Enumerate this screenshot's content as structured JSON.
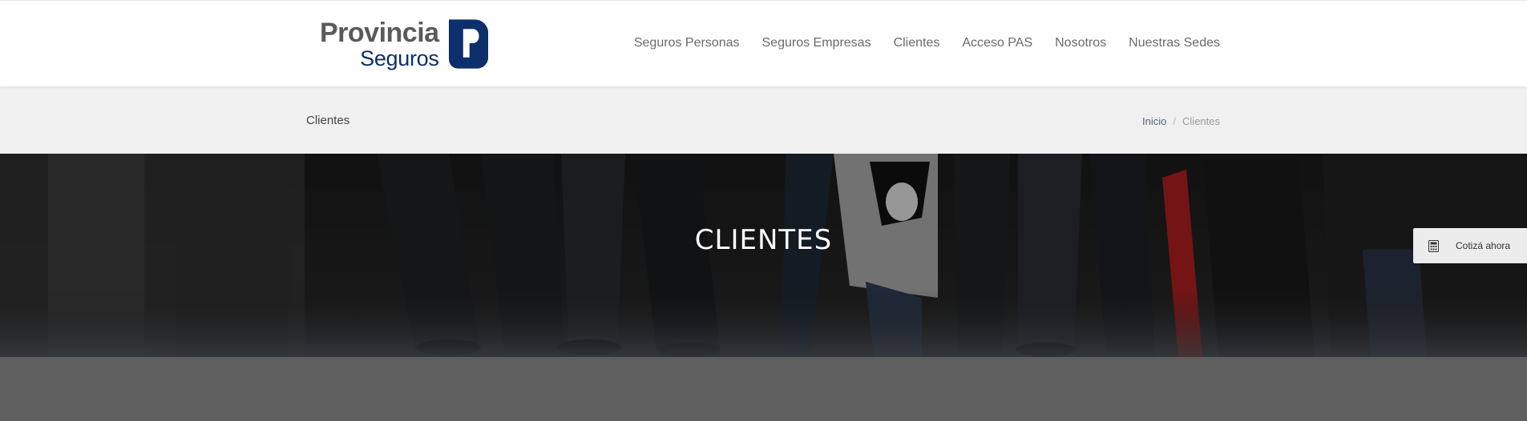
{
  "brand": {
    "top": "Provincia",
    "bottom": "Seguros",
    "logo_icon": "provincia-p-mark",
    "colors": {
      "gray": "#5a5a5a",
      "blue": "#0d2f6b"
    }
  },
  "nav": {
    "items": [
      {
        "label": "Seguros Personas"
      },
      {
        "label": "Seguros Empresas"
      },
      {
        "label": "Clientes"
      },
      {
        "label": "Acceso PAS"
      },
      {
        "label": "Nosotros"
      },
      {
        "label": "Nuestras Sedes"
      }
    ]
  },
  "subheader": {
    "title": "Clientes",
    "breadcrumb": {
      "home": "Inicio",
      "separator": "/",
      "current": "Clientes"
    }
  },
  "hero": {
    "title": "CLIENTES"
  },
  "quote_tab": {
    "icon": "calculator-icon",
    "label": "Cotizá ahora"
  }
}
